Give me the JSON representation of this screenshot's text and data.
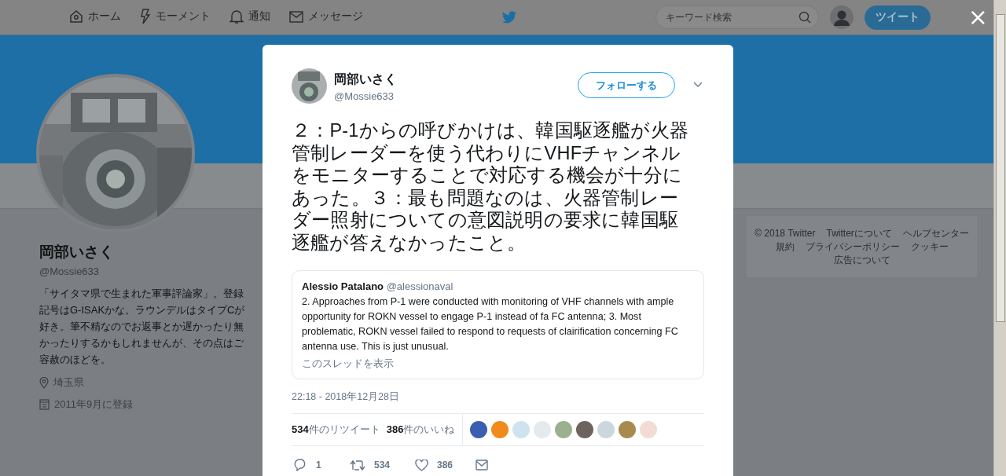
{
  "top_nav": {
    "items": [
      {
        "label": "ホーム",
        "selected": false
      },
      {
        "label": "モーメント",
        "selected": false
      },
      {
        "label": "通知",
        "selected": false
      },
      {
        "label": "メッセージ",
        "selected": false
      }
    ],
    "search": {
      "placeholder": "キーワード検索"
    },
    "tweet_button": "ツイート",
    "close": "×"
  },
  "profile": {
    "name": "岡部いさく",
    "handle": "@Mossie633",
    "bio": "「サイタマ県で生まれた軍事評論家」。登録記号はG-ISAKかな。ラウンデルはタイプCが好き。筆不精なのでお返事とか遅かったり無かったりするかもしれませんが、その点はご容赦のほどを。",
    "location": "埼玉県",
    "joined": "2011年9月に登録"
  },
  "footer": {
    "links": [
      "© 2018 Twitter",
      "Twitterについて",
      "ヘルプセンター",
      "規約",
      "プライバシーポリシー",
      "クッキー",
      "広告について"
    ]
  },
  "tweet": {
    "author": "岡部いさく",
    "handle": "@Mossie633",
    "follow_button": "フォローする",
    "text": "２：P-1からの呼びかけは、韓国駆逐艦が火器管制レーダーを使う代わりにVHFチャンネルをモニターすることで対応する機会が十分にあった。３：最も問題なのは、火器管制レーダー照射についての意図説明の要求に韓国駆逐艦が答えなかったこと。",
    "quote": {
      "author": "Alessio Patalano",
      "handle": "@alessionaval",
      "text": "2. Approaches from P-1 were conducted with monitoring of VHF channels with ample opportunity for ROKN vessel to engage P-1 instead of fa FC antenna; 3. Most problematic, ROKN vessel failed to respond to requests of clairification concerning FC antenna use. This is just unusual.",
      "link": "このスレッドを表示"
    },
    "timestamp": "22:18 - 2018年12月28日",
    "stats": [
      "**534**件のリツイート",
      "**386**件のいいね"
    ],
    "likers": [
      {
        "color": "#3a5fb0"
      },
      {
        "color": "#f08a1c"
      },
      {
        "color": "#cfe3ef"
      },
      {
        "color": "#e4eaee"
      },
      {
        "color": "#9bb08f"
      },
      {
        "color": "#6d625d"
      },
      {
        "color": "#ccd6dd"
      },
      {
        "color": "#a88a4f"
      },
      {
        "color": "#f2dcd3"
      }
    ],
    "actions": [
      {
        "kind": "reply",
        "count": "1"
      },
      {
        "kind": "retweet",
        "count": "534"
      },
      {
        "kind": "like",
        "count": "386"
      },
      {
        "kind": "message"
      }
    ]
  }
}
